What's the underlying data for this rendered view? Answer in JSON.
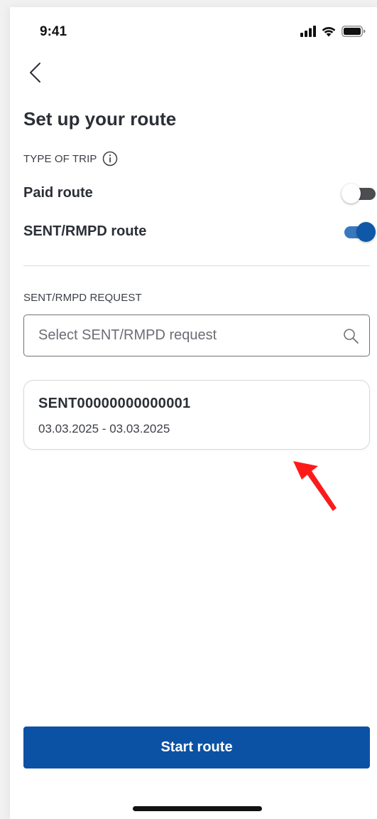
{
  "status_bar": {
    "time": "9:41",
    "icons": [
      "signal-icon",
      "wifi-icon",
      "battery-icon"
    ]
  },
  "header": {
    "back_icon": "chevron-left-icon",
    "title": "Set up your route"
  },
  "trip_type": {
    "label": "TYPE OF TRIP",
    "info_icon": "info-icon",
    "options": [
      {
        "label": "Paid route",
        "enabled": false
      },
      {
        "label": "SENT/RMPD route",
        "enabled": true
      }
    ]
  },
  "request": {
    "label": "SENT/RMPD REQUEST",
    "search_placeholder": "Select SENT/RMPD request",
    "search_value": "",
    "search_icon": "search-icon",
    "results": [
      {
        "id": "SENT00000000000001",
        "dates": "03.03.2025 - 03.03.2025"
      }
    ]
  },
  "actions": {
    "start_label": "Start route"
  },
  "colors": {
    "primary": "#0b52a5",
    "toggle_on_track": "#3a78bd",
    "toggle_off_track": "#4b4d51",
    "annotation_arrow": "#ff1a1a"
  }
}
